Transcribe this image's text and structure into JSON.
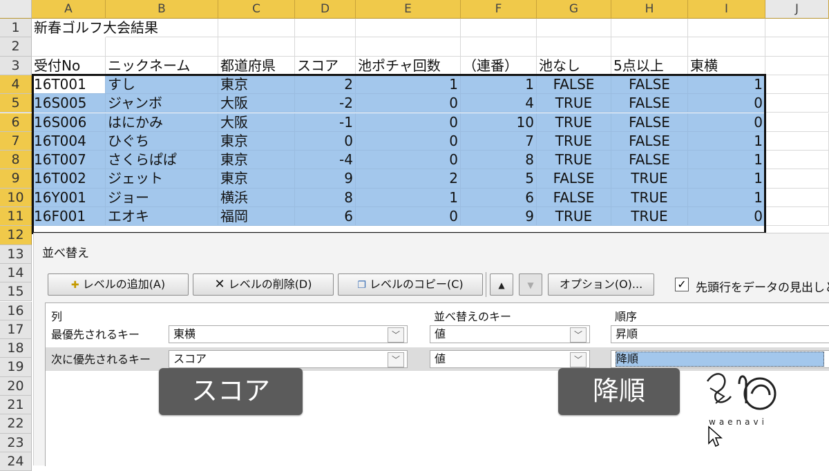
{
  "columns": [
    "A",
    "B",
    "C",
    "D",
    "E",
    "F",
    "G",
    "H",
    "I",
    "J"
  ],
  "rows": [
    "1",
    "2",
    "3",
    "4",
    "5",
    "6",
    "7",
    "8",
    "9",
    "10",
    "11",
    "12",
    "13",
    "14",
    "15",
    "16",
    "17",
    "18",
    "19",
    "20",
    "21",
    "22",
    "23",
    "24"
  ],
  "sheet": {
    "title": "新春ゴルフ大会結果",
    "headers": [
      "受付No",
      "ニックネーム",
      "都道府県",
      "スコア",
      "池ポチャ回数",
      "（連番）",
      "池なし",
      "5点以上",
      "東横"
    ],
    "data": [
      [
        "16T001",
        "すし",
        "東京",
        "2",
        "1",
        "1",
        "FALSE",
        "FALSE",
        "1"
      ],
      [
        "16S005",
        "ジャンボ",
        "大阪",
        "-2",
        "0",
        "4",
        "TRUE",
        "FALSE",
        "0"
      ],
      [
        "16S006",
        "はにかみ",
        "大阪",
        "-1",
        "0",
        "10",
        "TRUE",
        "FALSE",
        "0"
      ],
      [
        "16T004",
        "ひぐち",
        "東京",
        "0",
        "0",
        "7",
        "TRUE",
        "FALSE",
        "1"
      ],
      [
        "16T007",
        "さくらぱぱ",
        "東京",
        "-4",
        "0",
        "8",
        "TRUE",
        "FALSE",
        "1"
      ],
      [
        "16T002",
        "ジェット",
        "東京",
        "9",
        "2",
        "5",
        "FALSE",
        "TRUE",
        "1"
      ],
      [
        "16Y001",
        "ジョー",
        "横浜",
        "8",
        "1",
        "6",
        "FALSE",
        "TRUE",
        "1"
      ],
      [
        "16F001",
        "エオキ",
        "福岡",
        "6",
        "0",
        "9",
        "TRUE",
        "TRUE",
        "0"
      ]
    ]
  },
  "dialog": {
    "title": "並べ替え",
    "add_level": "レベルの追加(A)",
    "delete_level": "レベルの削除(D)",
    "copy_level": "レベルのコピー(C)",
    "options": "オプション(O)...",
    "header_checkbox_label": "先頭行をデータの見出しと",
    "header_checkbox_checked": true,
    "col_header": "列",
    "key_header": "並べ替えのキー",
    "order_header": "順序",
    "levels": [
      {
        "label": "最優先されるキー",
        "column": "東横",
        "key": "値",
        "order": "昇順"
      },
      {
        "label": "次に優先されるキー",
        "column": "スコア",
        "key": "値",
        "order": "降順"
      }
    ]
  },
  "captions": {
    "left": "スコア",
    "right": "降順"
  },
  "logo": {
    "text": "waenavi"
  },
  "colors": {
    "selection": "#a3c7ec",
    "header_highlight": "#f0c94a",
    "caption_bg": "#5b5b5b"
  }
}
